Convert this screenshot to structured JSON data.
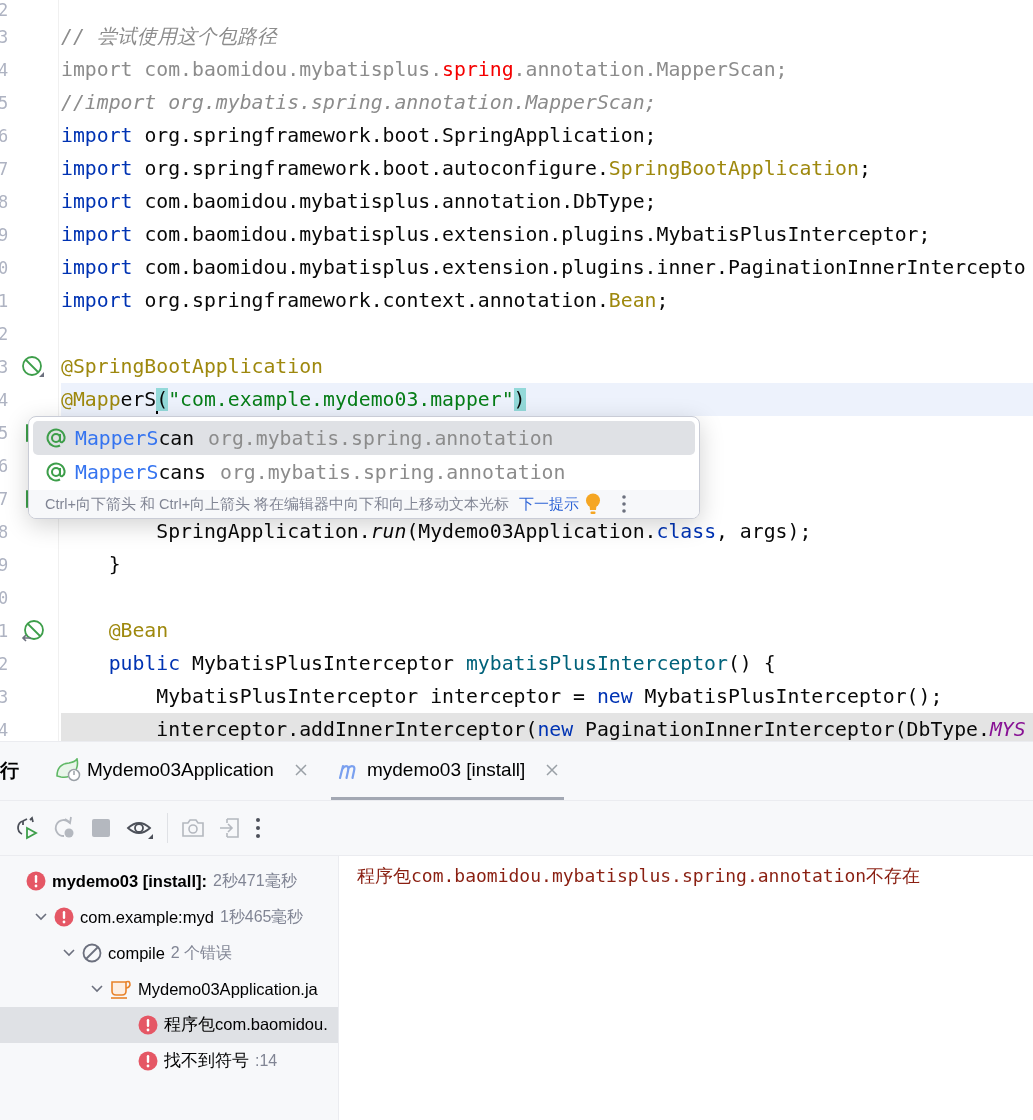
{
  "editor": {
    "lines": [
      {
        "number": "2",
        "kind": "plain",
        "current": false,
        "shaded": false
      },
      {
        "number": "3",
        "kind": "plain",
        "current": false,
        "shaded": false,
        "tokens": [
          {
            "kind": "comment",
            "text": "// 尝试使用这个包路径"
          }
        ]
      },
      {
        "number": "4",
        "kind": "plain",
        "current": false,
        "shaded": false,
        "tokens": [
          {
            "kind": "unused",
            "text": "import com.baomidou.mybatisplus."
          },
          {
            "kind": "error",
            "text": "spring"
          },
          {
            "kind": "unused",
            "text": ".annotation.MapperScan;"
          }
        ]
      },
      {
        "number": "5",
        "kind": "plain",
        "current": false,
        "shaded": false,
        "tokens": [
          {
            "kind": "comment",
            "text": "//import org.mybatis.spring.annotation.MapperScan;"
          }
        ]
      },
      {
        "number": "6",
        "kind": "plain",
        "current": false,
        "shaded": false,
        "tokens": [
          {
            "kind": "keyword",
            "text": "import"
          },
          {
            "kind": "plain",
            "text": " org.springframework.boot.SpringApplication;"
          }
        ]
      },
      {
        "number": "7",
        "kind": "plain",
        "current": false,
        "shaded": false,
        "tokens": [
          {
            "kind": "keyword",
            "text": "import"
          },
          {
            "kind": "plain",
            "text": " org.springframework.boot.autoconfigure."
          },
          {
            "kind": "annotation",
            "text": "SpringBootApplication"
          },
          {
            "kind": "plain",
            "text": ";"
          }
        ]
      },
      {
        "number": "8",
        "kind": "plain",
        "current": false,
        "shaded": false,
        "tokens": [
          {
            "kind": "keyword",
            "text": "import"
          },
          {
            "kind": "plain",
            "text": " com.baomidou.mybatisplus.annotation.DbType;"
          }
        ]
      },
      {
        "number": "9",
        "kind": "plain",
        "current": false,
        "shaded": false,
        "tokens": [
          {
            "kind": "keyword",
            "text": "import"
          },
          {
            "kind": "plain",
            "text": " com.baomidou.mybatisplus.extension.plugins.MybatisPlusInterceptor;"
          }
        ]
      },
      {
        "number": "0",
        "kind": "plain",
        "current": false,
        "shaded": false,
        "tokens": [
          {
            "kind": "keyword",
            "text": "import"
          },
          {
            "kind": "plain",
            "text": " com.baomidou.mybatisplus.extension.plugins.inner.PaginationInnerIntercepto"
          }
        ]
      },
      {
        "number": "1",
        "kind": "plain",
        "current": false,
        "shaded": false,
        "tokens": [
          {
            "kind": "keyword",
            "text": "import"
          },
          {
            "kind": "plain",
            "text": " org.springframework.context.annotation."
          },
          {
            "kind": "annotation",
            "text": "Bean"
          },
          {
            "kind": "plain",
            "text": ";"
          }
        ]
      },
      {
        "number": "2",
        "kind": "plain",
        "current": false,
        "shaded": false
      },
      {
        "number": "3",
        "kind": "bean",
        "current": false,
        "shaded": false,
        "tokens": [
          {
            "kind": "annotation",
            "text": "@SpringBootApplication"
          }
        ]
      },
      {
        "number": "4",
        "kind": "plain",
        "current": true,
        "shaded": false,
        "tokens": [
          {
            "kind": "annotation",
            "text": "@Mapp"
          },
          {
            "kind": "plain",
            "text": "erS"
          },
          {
            "kind": "caret"
          },
          {
            "kind": "brace_match",
            "text": "("
          },
          {
            "kind": "string",
            "text": "\"com.example.mydemo03.mapper\""
          },
          {
            "kind": "brace_match",
            "text": ")"
          }
        ]
      },
      {
        "number": "5",
        "kind": "run",
        "current": false,
        "shaded": false
      },
      {
        "number": "6",
        "kind": "plain",
        "current": false,
        "shaded": false
      },
      {
        "number": "7",
        "kind": "run",
        "current": false,
        "shaded": false
      },
      {
        "number": "8",
        "kind": "plain",
        "current": false,
        "shaded": false,
        "tokens": [
          {
            "kind": "plain",
            "text": "        SpringApplication."
          },
          {
            "kind": "static",
            "text": "run"
          },
          {
            "kind": "plain",
            "text": "(Mydemo03Application."
          },
          {
            "kind": "keyword",
            "text": "class"
          },
          {
            "kind": "plain",
            "text": ", args);"
          }
        ]
      },
      {
        "number": "9",
        "kind": "plain",
        "current": false,
        "shaded": false,
        "tokens": [
          {
            "kind": "plain",
            "text": "    }"
          }
        ]
      },
      {
        "number": "0",
        "kind": "plain",
        "current": false,
        "shaded": false
      },
      {
        "number": "1",
        "kind": "bean-link",
        "current": false,
        "shaded": false,
        "tokens": [
          {
            "kind": "annotation",
            "text": "    @Bean"
          }
        ]
      },
      {
        "number": "2",
        "kind": "plain",
        "current": false,
        "shaded": false,
        "tokens": [
          {
            "kind": "keyword",
            "text": "    public"
          },
          {
            "kind": "plain",
            "text": " MybatisPlusInterceptor "
          },
          {
            "kind": "method",
            "text": "mybatisPlusInterceptor"
          },
          {
            "kind": "plain",
            "text": "() {"
          }
        ]
      },
      {
        "number": "3",
        "kind": "plain",
        "current": false,
        "shaded": false,
        "tokens": [
          {
            "kind": "plain",
            "text": "        MybatisPlusInterceptor interceptor = "
          },
          {
            "kind": "keyword",
            "text": "new"
          },
          {
            "kind": "plain",
            "text": " MybatisPlusInterceptor();"
          }
        ]
      },
      {
        "number": "4",
        "kind": "plain",
        "current": false,
        "shaded": true,
        "tokens": [
          {
            "kind": "plain",
            "text": "        interceptor.addInnerInterceptor("
          },
          {
            "kind": "keyword",
            "text": "new"
          },
          {
            "kind": "plain",
            "text": " PaginationInnerInterceptor(DbType."
          },
          {
            "kind": "field",
            "text": "MYS"
          }
        ]
      }
    ],
    "completion": {
      "items": [
        {
          "match": "MapperS",
          "rest": "can",
          "package": "org.mybatis.spring.annotation",
          "selected": true
        },
        {
          "match": "MapperS",
          "rest": "cans",
          "package": "org.mybatis.spring.annotation",
          "selected": false
        }
      ],
      "hint": "Ctrl+向下箭头 和 Ctrl+向上箭头 将在编辑器中向下和向上移动文本光标",
      "link": "下一提示"
    }
  },
  "run_panel": {
    "title": "行",
    "tabs": [
      {
        "label": "Mydemo03Application",
        "selected": false
      },
      {
        "label": "mydemo03 [install]",
        "selected": true
      }
    ],
    "toolbar": [
      {
        "disabled": false
      },
      {
        "disabled": true
      },
      {
        "disabled": true
      },
      {
        "disabled": false
      },
      {
        "disabled": true
      },
      {
        "disabled": true
      },
      {
        "disabled": false
      }
    ],
    "tree": [
      {
        "label": "mydemo03 [install]:",
        "time": "2秒471毫秒",
        "kind": "error",
        "selected": false,
        "children": [
          {
            "label": "com.example:myd",
            "time": "1秒465毫秒",
            "kind": "error",
            "expanded": true,
            "selected": false,
            "children": [
              {
                "label": "compile",
                "time": "2 个错误",
                "kind": "skipped",
                "expanded": true,
                "selected": false,
                "children": [
                  {
                    "label": "Mydemo03Application.ja",
                    "kind": "file",
                    "expanded": true,
                    "selected": false,
                    "children": [
                      {
                        "label": "程序包com.baomidou.",
                        "kind": "error",
                        "selected": true
                      },
                      {
                        "label": "找不到符号",
                        "time": ":14",
                        "kind": "error",
                        "selected": false
                      }
                    ]
                  }
                ]
              }
            ]
          }
        ]
      }
    ],
    "output": [
      {
        "kind": "cjk",
        "text": "程序包"
      },
      {
        "kind": "code",
        "text": "com.baomidou.mybatisplus.spring.annotation"
      },
      {
        "kind": "cjk",
        "text": "不存在"
      }
    ]
  }
}
